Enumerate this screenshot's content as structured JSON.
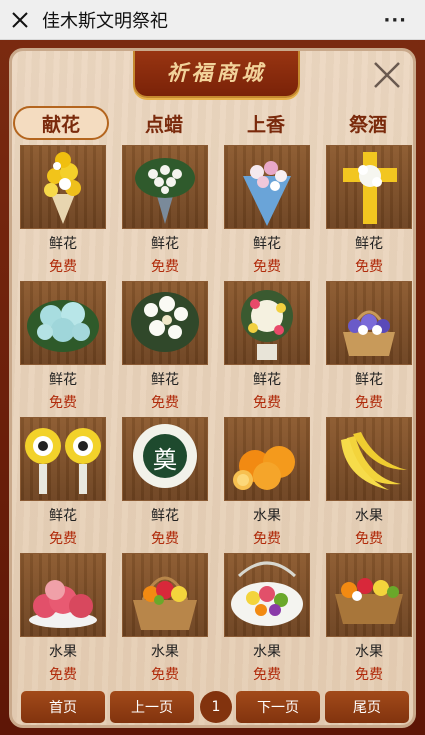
{
  "topbar": {
    "title": "佳木斯文明祭祀",
    "more_label": "···"
  },
  "shop": {
    "banner_title": "祈福商城"
  },
  "tabs": [
    {
      "label": "献花",
      "active": true
    },
    {
      "label": "点蜡",
      "active": false
    },
    {
      "label": "上香",
      "active": false
    },
    {
      "label": "祭酒",
      "active": false
    }
  ],
  "items": [
    {
      "name": "鲜花",
      "price": "免费",
      "icon": "yellow-bouquet"
    },
    {
      "name": "鲜花",
      "price": "免费",
      "icon": "white-rose-bouquet"
    },
    {
      "name": "鲜花",
      "price": "免费",
      "icon": "blue-wrapped-bouquet"
    },
    {
      "name": "鲜花",
      "price": "免费",
      "icon": "chrysanthemum-cross"
    },
    {
      "name": "鲜花",
      "price": "免费",
      "icon": "blue-hydrangea"
    },
    {
      "name": "鲜花",
      "price": "免费",
      "icon": "white-lily-bouquet"
    },
    {
      "name": "鲜花",
      "price": "免费",
      "icon": "wreath-stand"
    },
    {
      "name": "鲜花",
      "price": "免费",
      "icon": "purple-flower-basket"
    },
    {
      "name": "鲜花",
      "price": "免费",
      "icon": "twin-memorial-wreaths"
    },
    {
      "name": "鲜花",
      "price": "免费",
      "icon": "memorial-wreath",
      "emblem": "奠"
    },
    {
      "name": "水果",
      "price": "免费",
      "icon": "oranges"
    },
    {
      "name": "水果",
      "price": "免费",
      "icon": "bananas"
    },
    {
      "name": "水果",
      "price": "免费",
      "icon": "peaches"
    },
    {
      "name": "水果",
      "price": "免费",
      "icon": "fruit-basket"
    },
    {
      "name": "水果",
      "price": "免费",
      "icon": "fruit-platter"
    },
    {
      "name": "水果",
      "price": "免费",
      "icon": "mixed-fruit-basket"
    }
  ],
  "pager": {
    "first": "首页",
    "prev": "上一页",
    "current": "1",
    "next": "下一页",
    "last": "尾页"
  },
  "colors": {
    "accent": "#82330e",
    "price": "#b02a0a",
    "tab_text": "#7a2a0c"
  }
}
